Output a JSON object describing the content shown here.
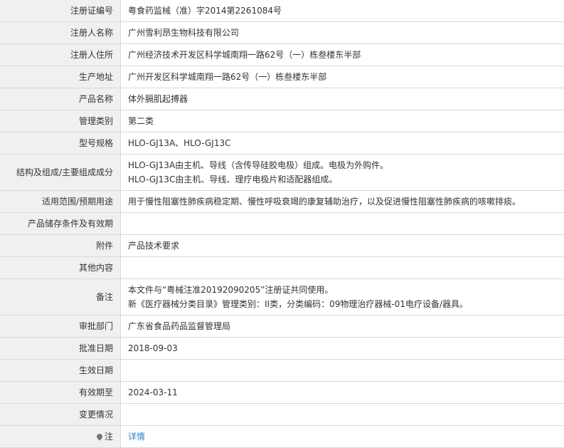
{
  "rows": [
    {
      "label": "注册证编号",
      "lines": [
        "粤食药监械（准）字2014第2261084号"
      ]
    },
    {
      "label": "注册人名称",
      "lines": [
        "广州雪利昂生物科技有限公司"
      ]
    },
    {
      "label": "注册人住所",
      "lines": [
        "广州经济技术开发区科学城南翔一路62号（一）栋叁楼东半部"
      ]
    },
    {
      "label": "生产地址",
      "lines": [
        "广州开发区科学城南翔一路62号（一）栋叁楼东半部"
      ]
    },
    {
      "label": "产品名称",
      "lines": [
        "体外膈肌起搏器"
      ]
    },
    {
      "label": "管理类别",
      "lines": [
        "第二类"
      ]
    },
    {
      "label": "型号规格",
      "lines": [
        "HLO-GJ13A、HLO-GJ13C"
      ]
    },
    {
      "label": "结构及组成/主要组成成分",
      "lines": [
        "HLO-GJ13A由主机、导线（含传导硅胶电极）组成。电极为外购件。",
        "HLO-GJ13C由主机、导线、理疗电极片和适配器组成。"
      ]
    },
    {
      "label": "适用范围/预期用途",
      "lines": [
        "用于慢性阻塞性肺疾病稳定期、慢性呼吸衰竭的康复辅助治疗，以及促进慢性阻塞性肺疾病的咳嗽排痰。"
      ]
    },
    {
      "label": "产品储存条件及有效期",
      "lines": [
        ""
      ]
    },
    {
      "label": "附件",
      "lines": [
        "产品技术要求"
      ]
    },
    {
      "label": "其他内容",
      "lines": [
        ""
      ]
    },
    {
      "label": "备注",
      "lines": [
        "本文件与“粤械注准20192090205”注册证共同使用。",
        "新《医疗器械分类目录》管理类别：II类，分类编码：09物理治疗器械-01电疗设备/器具。"
      ]
    },
    {
      "label": "审批部门",
      "lines": [
        "广东省食品药品监督管理局"
      ]
    },
    {
      "label": "批准日期",
      "lines": [
        "2018-09-03"
      ]
    },
    {
      "label": "生效日期",
      "lines": [
        ""
      ]
    },
    {
      "label": "有效期至",
      "lines": [
        "2024-03-11"
      ]
    },
    {
      "label": "变更情况",
      "lines": [
        ""
      ]
    }
  ],
  "note_row": {
    "label": "注",
    "icon": "pin-icon",
    "link_text": "详情"
  }
}
